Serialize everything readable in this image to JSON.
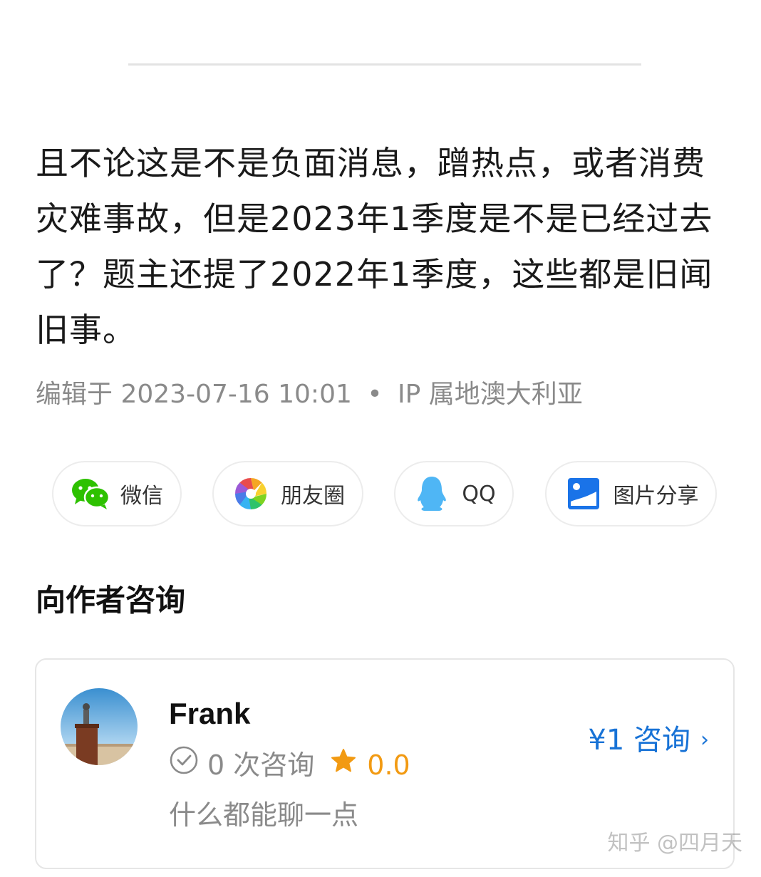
{
  "article": {
    "body": "且不论这是不是负面消息，蹭热点，或者消费灾难事故，但是2023年1季度是不是已经过去了？题主还提了2022年1季度，这些都是旧闻旧事。",
    "edited_label": "编辑于",
    "edited_time": "2023-07-16 10:01",
    "dot": "•",
    "ip_label": "IP 属地澳大利亚"
  },
  "share": {
    "buttons": [
      {
        "label": "微信",
        "icon": "wechat-icon"
      },
      {
        "label": "朋友圈",
        "icon": "moments-icon"
      },
      {
        "label": "QQ",
        "icon": "qq-icon"
      },
      {
        "label": "图片分享",
        "icon": "image-share-icon"
      }
    ]
  },
  "consult": {
    "section_title": "向作者咨询",
    "author_name": "Frank",
    "count_text": "0 次咨询",
    "rating": "0.0",
    "bio": "什么都能聊一点",
    "price_action": "¥1 咨询",
    "chevron": "›"
  },
  "watermark": "知乎 @四月天",
  "colors": {
    "link_blue": "#1772d6",
    "rating_orange": "#f29a12",
    "meta_gray": "#8a8a8a",
    "wechat_green": "#2dc100",
    "qq_blue": "#4fb6f5"
  }
}
